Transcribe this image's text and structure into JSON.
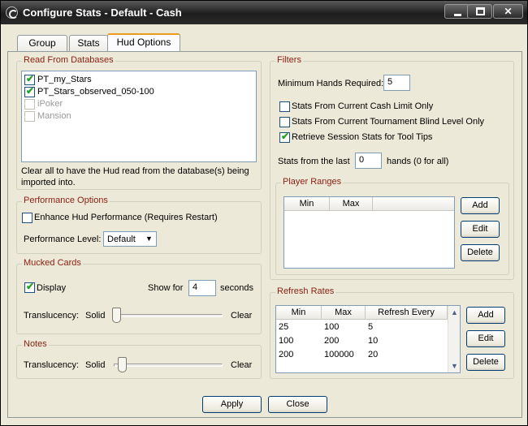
{
  "window": {
    "title": "Configure Stats - Default - Cash",
    "minimize_icon": "minimize-icon",
    "maximize_icon": "maximize-icon",
    "close_glyph": "✕"
  },
  "tabs": [
    {
      "label": "Group"
    },
    {
      "label": "Stats"
    },
    {
      "label": "Hud Options",
      "active": true
    }
  ],
  "read_databases": {
    "title": "Read From Databases",
    "items": [
      {
        "label": "PT_my_Stars",
        "checked": true,
        "enabled": true
      },
      {
        "label": "PT_Stars_observed_050-100",
        "checked": true,
        "enabled": true
      },
      {
        "label": "iPoker",
        "checked": false,
        "enabled": false
      },
      {
        "label": "Mansion",
        "checked": false,
        "enabled": false
      }
    ],
    "help_line1": "Clear all to have the Hud read from the database(s) being",
    "help_line2": "imported into."
  },
  "performance": {
    "title": "Performance Options",
    "enhance_label": "Enhance Hud Performance (Requires Restart)",
    "enhance_checked": false,
    "level_label": "Performance Level:",
    "level_value": "Default"
  },
  "mucked": {
    "title": "Mucked Cards",
    "display_label": "Display",
    "display_checked": true,
    "show_for_label": "Show for",
    "show_for_value": "4",
    "seconds_label": "seconds",
    "translucency_label": "Translucency:",
    "solid_label": "Solid",
    "clear_label": "Clear",
    "translucency_level": 0
  },
  "notes": {
    "title": "Notes",
    "translucency_label": "Translucency:",
    "solid_label": "Solid",
    "clear_label": "Clear",
    "translucency_level": 0.06
  },
  "filters": {
    "title": "Filters",
    "min_hands_label": "Minimum Hands Required:",
    "min_hands_value": "5",
    "checks": [
      {
        "label": "Stats From Current Cash Limit Only",
        "checked": false
      },
      {
        "label": "Stats From Current Tournament Blind Level Only",
        "checked": false
      },
      {
        "label": "Retrieve Session Stats for Tool Tips",
        "checked": true
      }
    ],
    "stats_from_last_label": "Stats from the last",
    "stats_from_last_value": "0",
    "hands_label": "hands (0 for all)"
  },
  "player_ranges": {
    "title": "Player Ranges",
    "col_min": "Min",
    "col_max": "Max",
    "add_label": "Add",
    "edit_label": "Edit",
    "delete_label": "Delete"
  },
  "refresh_rates": {
    "title": "Refresh Rates",
    "col_min": "Min",
    "col_max": "Max",
    "col_refresh": "Refresh Every",
    "rows": [
      {
        "min": "25",
        "max": "100",
        "refresh": "5"
      },
      {
        "min": "100",
        "max": "200",
        "refresh": "10"
      },
      {
        "min": "200",
        "max": "100000",
        "refresh": "20"
      }
    ],
    "add_label": "Add",
    "edit_label": "Edit",
    "delete_label": "Delete"
  },
  "footer": {
    "apply_label": "Apply",
    "close_label": "Close"
  },
  "icons": {
    "checkmark": "✔",
    "dropdown_arrow": "▼",
    "scroll_up": "▲",
    "scroll_down": "▼"
  }
}
